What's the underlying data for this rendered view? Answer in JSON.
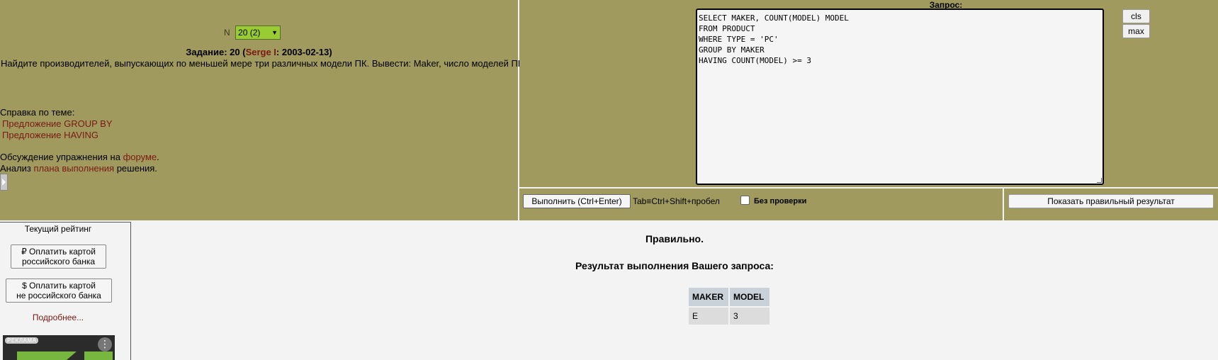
{
  "task": {
    "n_label": "N",
    "n_value": "20 (2)",
    "title_prefix": "Задание: 20 (",
    "author": "Serge I",
    "title_suffix": ": 2003-02-13)",
    "text": "Найдите производителей, выпускающих по меньшей мере три различных модели ПК. Вывести: Maker, число моделей ПК."
  },
  "help": {
    "label": "Справка по теме:",
    "links": [
      "Предложение GROUP BY",
      "Предложение HAVING"
    ],
    "discuss_prefix": "Обсуждение упражнения на ",
    "discuss_link": "форуме",
    "discuss_suffix": ".",
    "analysis_prefix": "Анализ ",
    "analysis_link": "плана выполнения",
    "analysis_suffix": " решения."
  },
  "query": {
    "label": "Запрос:",
    "sql": "SELECT MAKER, COUNT(MODEL) MODEL\nFROM PRODUCT\nWHERE TYPE = 'PC'\nGROUP BY MAKER\nHAVING COUNT(MODEL) >= 3",
    "cls_label": "cls",
    "max_label": "max"
  },
  "run_bar": {
    "run_label": "Выполнить (Ctrl+Enter)",
    "tab_hint": "Tab≡Ctrl+Shift+пробел",
    "no_check_label": "Без проверки",
    "show_result_label": "Показать правильный результат"
  },
  "sidebar": {
    "rating": "Текущий рейтинг",
    "pay_ru_line1": "₽ Оплатить картой",
    "pay_ru_line2": "российского банка",
    "pay_nonru_line1": "$ Оплатить картой",
    "pay_nonru_line2": "не российского банка",
    "more": "Подробнее...",
    "ad_label": "РЕКЛАМА"
  },
  "result": {
    "status": "Правильно.",
    "heading": "Результат выполнения Вашего запроса:",
    "columns": [
      "MAKER",
      "MODEL"
    ],
    "rows": [
      [
        "E",
        "3"
      ]
    ]
  }
}
